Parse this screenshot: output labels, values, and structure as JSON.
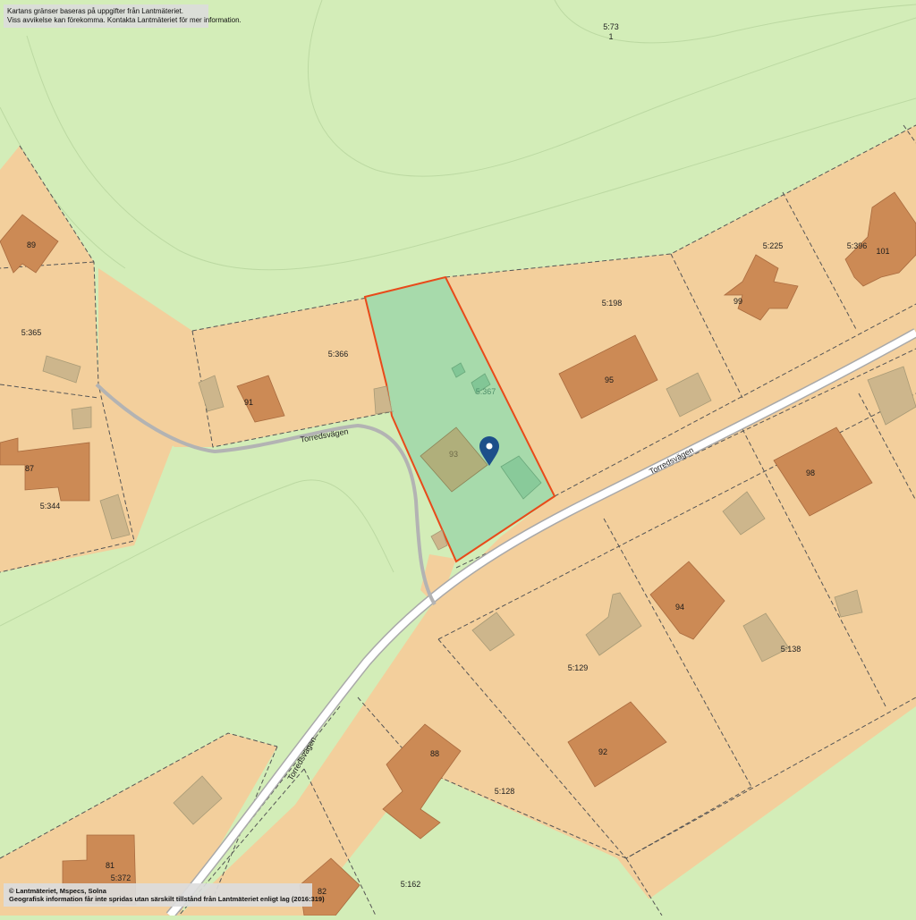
{
  "notice": {
    "line1": "Kartans gränser baseras på uppgifter från Lantmäteriet.",
    "line2": "Viss avvikelse kan förekomma. Kontakta Lantmäteriet för mer information."
  },
  "copyright": {
    "line1": "© Lantmäteriet, Mspecs, Solna",
    "line2": "Geografisk information får inte spridas utan särskilt tillstånd från Lantmäteriet enligt lag (2016:319)"
  },
  "colors": {
    "forest": "#d3edb8",
    "plot": "#f3cf9c",
    "house": "#cc8a55",
    "outbuilding": "#cdb68c",
    "highlight_fill": "#9fd6a8",
    "highlight_border": "#e84a1a",
    "road": "#ffffff",
    "path": "#b3b3b3",
    "marker": "#1d4f8a"
  },
  "map": {
    "selected_parcel": "5:367",
    "selected_house": "93",
    "marker_icon": "location-pin-icon",
    "parcels": [
      "5:73",
      "1",
      "5:365",
      "5:344",
      "5:366",
      "5:367",
      "5:198",
      "5:225",
      "5:396",
      "5:129",
      "5:138",
      "5:128",
      "5:372",
      "5:162"
    ],
    "house_numbers": [
      "89",
      "87",
      "91",
      "93",
      "95",
      "99",
      "101",
      "98",
      "94",
      "92",
      "88",
      "81",
      "82"
    ],
    "roads": [
      "Torredsvägen",
      "Torredsvägen",
      "Torredsvägen"
    ]
  }
}
